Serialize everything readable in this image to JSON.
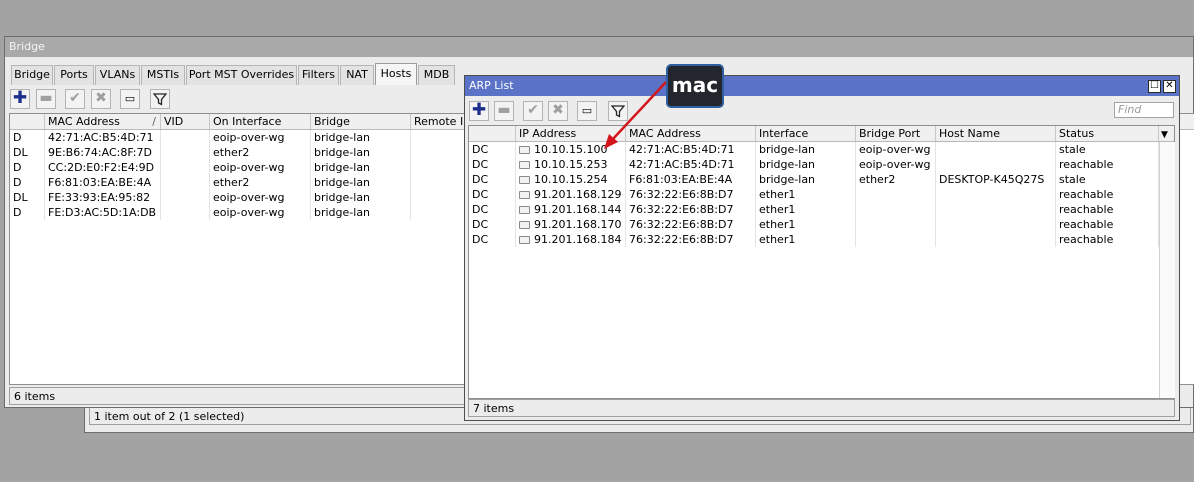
{
  "back_window": {
    "status": "1 item out of 2 (1 selected)"
  },
  "bridge_window": {
    "title": "Bridge",
    "tabs": [
      "Bridge",
      "Ports",
      "VLANs",
      "MSTIs",
      "Port MST Overrides",
      "Filters",
      "NAT",
      "Hosts",
      "MDB"
    ],
    "active_tab": "Hosts",
    "columns": [
      "",
      "MAC Address",
      "VID",
      "On Interface",
      "Bridge",
      "Remote IP"
    ],
    "sort_glyph": "/",
    "rows": [
      [
        "D",
        "42:71:AC:B5:4D:71",
        "",
        "eoip-over-wg",
        "bridge-lan",
        ""
      ],
      [
        "DL",
        "9E:B6:74:AC:8F:7D",
        "",
        "ether2",
        "bridge-lan",
        ""
      ],
      [
        "D",
        "CC:2D:E0:F2:E4:9D",
        "",
        "eoip-over-wg",
        "bridge-lan",
        ""
      ],
      [
        "D",
        "F6:81:03:EA:BE:4A",
        "",
        "ether2",
        "bridge-lan",
        ""
      ],
      [
        "DL",
        "FE:33:93:EA:95:82",
        "",
        "eoip-over-wg",
        "bridge-lan",
        ""
      ],
      [
        "D",
        "FE:D3:AC:5D:1A:DB",
        "",
        "eoip-over-wg",
        "bridge-lan",
        ""
      ]
    ],
    "status": "6 items"
  },
  "arp_window": {
    "title": "ARP List",
    "find_placeholder": "Find",
    "columns": [
      "",
      "IP Address",
      "MAC Address",
      "Interface",
      "Bridge Port",
      "Host Name",
      "Status"
    ],
    "rows": [
      [
        "DC",
        "10.10.15.100",
        "42:71:AC:B5:4D:71",
        "bridge-lan",
        "eoip-over-wg",
        "",
        "stale"
      ],
      [
        "DC",
        "10.10.15.253",
        "42:71:AC:B5:4D:71",
        "bridge-lan",
        "eoip-over-wg",
        "",
        "reachable"
      ],
      [
        "DC",
        "10.10.15.254",
        "F6:81:03:EA:BE:4A",
        "bridge-lan",
        "ether2",
        "DESKTOP-K45Q27S",
        "stale"
      ],
      [
        "DC",
        "91.201.168.129",
        "76:32:22:E6:8B:D7",
        "ether1",
        "",
        "",
        "reachable"
      ],
      [
        "DC",
        "91.201.168.144",
        "76:32:22:E6:8B:D7",
        "ether1",
        "",
        "",
        "reachable"
      ],
      [
        "DC",
        "91.201.168.170",
        "76:32:22:E6:8B:D7",
        "ether1",
        "",
        "",
        "reachable"
      ],
      [
        "DC",
        "91.201.168.184",
        "76:32:22:E6:8B:D7",
        "ether1",
        "",
        "",
        "reachable"
      ]
    ],
    "status": "7 items"
  },
  "callout": {
    "text": "mac"
  },
  "icons": {
    "add": "plus-icon",
    "remove": "minus-icon",
    "enable": "check-icon",
    "disable": "x-icon",
    "comment": "comment-icon",
    "filter": "filter-icon"
  },
  "colors": {
    "arp_title_bar": "#5b73c7",
    "annotation_arrow": "#d4161c",
    "callout_bg": "#23262c",
    "callout_border": "#2f5fa0"
  }
}
